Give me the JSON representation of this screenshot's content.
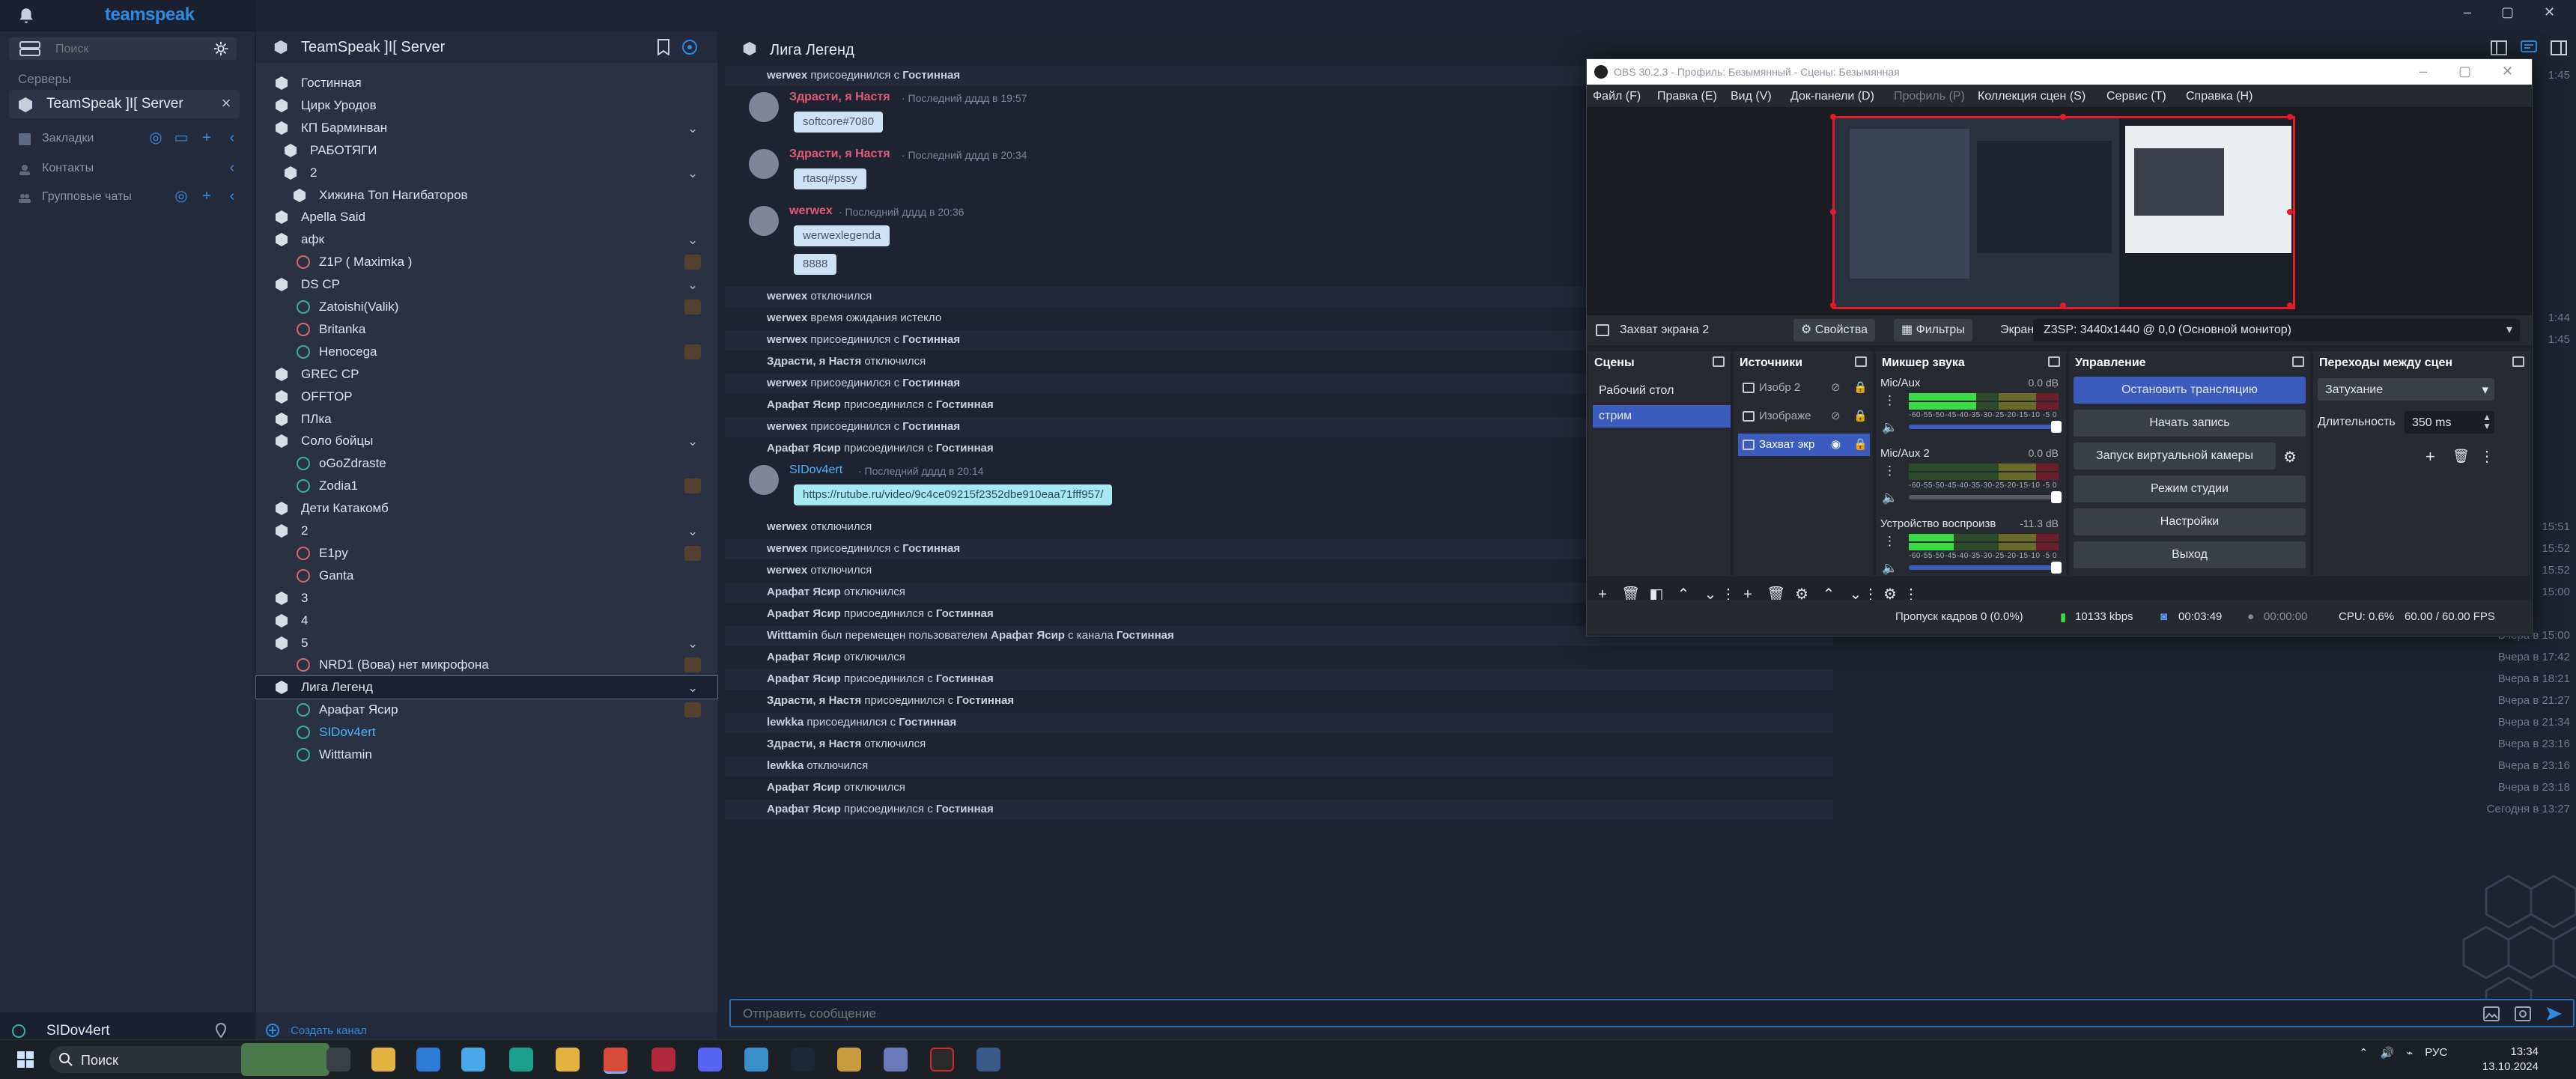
{
  "sidebar": {
    "brand": "teamspeak",
    "search_placeholder": "Поиск",
    "servers_label": "Серверы",
    "server_name": "TeamSpeak ]I[ Server",
    "sections": [
      "Закладки",
      "Контакты",
      "Групповые чаты"
    ],
    "user_name": "SIDov4ert"
  },
  "tree": {
    "server_title": "TeamSpeak ]I[ Server",
    "rows": [
      {
        "type": "channel",
        "label": "Гостинная",
        "depth": 0
      },
      {
        "type": "channel",
        "label": "Цирк Уродов",
        "depth": 0
      },
      {
        "type": "channel",
        "label": "КП Барминван",
        "depth": 0,
        "chev": true
      },
      {
        "type": "channel",
        "label": "РАБОТЯГИ",
        "depth": 1
      },
      {
        "type": "channel",
        "label": "2",
        "depth": 1,
        "chev": true
      },
      {
        "type": "channel",
        "label": "Хижина Топ Нагибаторов",
        "depth": 2
      },
      {
        "type": "channel",
        "label": "Apella Said",
        "depth": 0
      },
      {
        "type": "channel",
        "label": "афк",
        "depth": 0,
        "chev": true
      },
      {
        "type": "user-mic",
        "label": "Z1P ( Maximka )",
        "depth": 1,
        "badge": true
      },
      {
        "type": "channel",
        "label": "DS CP",
        "depth": 0,
        "chev": true
      },
      {
        "type": "user",
        "label": "Zatoishi(Valik)",
        "depth": 1,
        "badge": true
      },
      {
        "type": "user-mic",
        "label": "Britanka",
        "depth": 1
      },
      {
        "type": "user",
        "label": "Henocega",
        "depth": 1,
        "badge": true
      },
      {
        "type": "channel",
        "label": "GREC CP",
        "depth": 0
      },
      {
        "type": "channel",
        "label": "OFFTOP",
        "depth": 0
      },
      {
        "type": "channel",
        "label": "ПЛка",
        "depth": 0
      },
      {
        "type": "channel",
        "label": "Соло бойцы",
        "depth": 0,
        "chev": true
      },
      {
        "type": "user",
        "label": "oGoZdraste",
        "depth": 1
      },
      {
        "type": "user",
        "label": "Zodia1",
        "depth": 1,
        "badge": true
      },
      {
        "type": "channel",
        "label": "Дети Катакомб",
        "depth": 0
      },
      {
        "type": "channel",
        "label": "2",
        "depth": 0,
        "chev": true
      },
      {
        "type": "user-mic",
        "label": "E1py",
        "depth": 1,
        "badge": true
      },
      {
        "type": "user-mic",
        "label": "Ganta",
        "depth": 1
      },
      {
        "type": "channel",
        "label": "3",
        "depth": 0
      },
      {
        "type": "channel",
        "label": "4",
        "depth": 0
      },
      {
        "type": "channel",
        "label": "5",
        "depth": 0,
        "chev": true
      },
      {
        "type": "user-mic",
        "label": "NRD1 (Вова) нет микрофона",
        "depth": 1,
        "badge": true
      },
      {
        "type": "channel-sel",
        "label": "Лига Легенд",
        "depth": 0,
        "chev": true
      },
      {
        "type": "user",
        "label": "Арафат Ясир",
        "depth": 1,
        "badge": true
      },
      {
        "type": "user-me",
        "label": "SIDov4ert",
        "depth": 1
      },
      {
        "type": "user",
        "label": "Witttamin",
        "depth": 1
      }
    ],
    "create_channel": "Создать канал"
  },
  "chat": {
    "title": "Лига Легенд",
    "messages": [
      {
        "kind": "event",
        "html_parts": [
          {
            "b": "werwex"
          },
          {
            "t": " присоединился с "
          },
          {
            "b": "Гостинная"
          }
        ]
      },
      {
        "kind": "msg",
        "name": "Здрасти, я Настя",
        "time": "· Последний дддд в 19:57",
        "bubble": "softcore#7080"
      },
      {
        "kind": "msg",
        "name": "Здрасти, я Настя",
        "time": "· Последний дддд в 20:34",
        "bubble": "rtasq#pssy"
      },
      {
        "kind": "msg2",
        "name": "werwex",
        "time": "· Последний дддд в 20:36",
        "bubbles": [
          "werwexlegenda",
          "8888"
        ]
      },
      {
        "kind": "event",
        "html_parts": [
          {
            "b": "werwex"
          },
          {
            "t": " отключился"
          }
        ]
      },
      {
        "kind": "event",
        "html_parts": [
          {
            "b": "werwex"
          },
          {
            "t": " время ожидания истекло"
          }
        ]
      },
      {
        "kind": "event",
        "html_parts": [
          {
            "b": "werwex"
          },
          {
            "t": " присоединился с "
          },
          {
            "b": "Гостинная"
          }
        ]
      },
      {
        "kind": "event",
        "html_parts": [
          {
            "b": "Здрасти, я Настя"
          },
          {
            "t": " отключился"
          }
        ]
      },
      {
        "kind": "event",
        "html_parts": [
          {
            "b": "werwex"
          },
          {
            "t": " присоединился с "
          },
          {
            "b": "Гостинная"
          }
        ]
      },
      {
        "kind": "event",
        "html_parts": [
          {
            "b": "Арафат Ясир"
          },
          {
            "t": " присоединился с "
          },
          {
            "b": "Гостинная"
          }
        ]
      },
      {
        "kind": "event",
        "html_parts": [
          {
            "b": "werwex"
          },
          {
            "t": " присоединился с "
          },
          {
            "b": "Гостинная"
          }
        ]
      },
      {
        "kind": "event",
        "html_parts": [
          {
            "b": "Арафат Ясир"
          },
          {
            "t": " присоединился с "
          },
          {
            "b": "Гостинная"
          }
        ]
      },
      {
        "kind": "msglink",
        "name": "SIDov4ert",
        "time": "· Последний дддд в 20:14",
        "bubble": "https://rutube.ru/video/9c4ce09215f2352dbe910eaa71fff957/"
      },
      {
        "kind": "event",
        "html_parts": [
          {
            "b": "werwex"
          },
          {
            "t": " отключился"
          }
        ]
      },
      {
        "kind": "event",
        "html_parts": [
          {
            "b": "werwex"
          },
          {
            "t": " присоединился с "
          },
          {
            "b": "Гостинная"
          }
        ]
      },
      {
        "kind": "event",
        "html_parts": [
          {
            "b": "werwex"
          },
          {
            "t": " отключился"
          }
        ]
      },
      {
        "kind": "event",
        "html_parts": [
          {
            "b": "Арафат Ясир"
          },
          {
            "t": " отключился"
          }
        ]
      },
      {
        "kind": "event",
        "html_parts": [
          {
            "b": "Арафат Ясир"
          },
          {
            "t": " присоединился с "
          },
          {
            "b": "Гостинная"
          }
        ]
      },
      {
        "kind": "event",
        "html_parts": [
          {
            "b": "Witttamin"
          },
          {
            "t": " был перемещен пользователем "
          },
          {
            "b": "Арафат Ясир"
          },
          {
            "t": " с канала "
          },
          {
            "b": "Гостинная"
          }
        ]
      },
      {
        "kind": "event",
        "html_parts": [
          {
            "b": "Арафат Ясир"
          },
          {
            "t": " отключился"
          }
        ]
      },
      {
        "kind": "event",
        "html_parts": [
          {
            "b": "Арафат Ясир"
          },
          {
            "t": " присоединился с "
          },
          {
            "b": "Гостинная"
          }
        ]
      },
      {
        "kind": "event",
        "html_parts": [
          {
            "b": "Здрасти, я Настя"
          },
          {
            "t": " присоединился с "
          },
          {
            "b": "Гостинная"
          }
        ]
      },
      {
        "kind": "event",
        "html_parts": [
          {
            "b": "lewkka"
          },
          {
            "t": " присоединился с "
          },
          {
            "b": "Гостинная"
          }
        ]
      },
      {
        "kind": "event",
        "html_parts": [
          {
            "b": "Здрасти, я Настя"
          },
          {
            "t": " отключился"
          }
        ]
      },
      {
        "kind": "event",
        "html_parts": [
          {
            "b": "lewkka"
          },
          {
            "t": " отключился"
          }
        ]
      },
      {
        "kind": "event",
        "html_parts": [
          {
            "b": "Арафат Ясир"
          },
          {
            "t": " отключился"
          }
        ]
      },
      {
        "kind": "event",
        "html_parts": [
          {
            "b": "Арафат Ясир"
          },
          {
            "t": " присоединился с "
          },
          {
            "b": "Гостинная"
          }
        ]
      }
    ],
    "timestamps": [
      {
        "row": 0,
        "text": "1:45"
      },
      {
        "row": 5,
        "text": "1:44"
      },
      {
        "row": 6,
        "text": "1:45"
      },
      {
        "row": 13,
        "text": "15:51"
      },
      {
        "row": 14,
        "text": "15:52"
      },
      {
        "row": 15,
        "text": "15:52"
      },
      {
        "row": 16,
        "text": "15:00"
      },
      {
        "row": 18,
        "text": "Вчера в 15:00"
      },
      {
        "row": 19,
        "text": "Вчера в 17:42"
      },
      {
        "row": 20,
        "text": "Вчера в 18:21"
      },
      {
        "row": 21,
        "text": "Вчера в 21:27"
      },
      {
        "row": 22,
        "text": "Вчера в 21:34"
      },
      {
        "row": 23,
        "text": "Вчера в 23:16"
      },
      {
        "row": 24,
        "text": "Вчера в 23:16"
      },
      {
        "row": 25,
        "text": "Вчера в 23:18"
      },
      {
        "row": 26,
        "text": "Сегодня в 13:27"
      }
    ],
    "input_placeholder": "Отправить сообщение"
  },
  "obs": {
    "title": "OBS 30.2.3 - Профиль: Безымянный - Сцены: Безымянная",
    "menu": [
      "Файл (F)",
      "Правка (E)",
      "Вид (V)",
      "Док-панели (D)",
      "Профиль (P)",
      "Коллекция сцен (S)",
      "Сервис (T)",
      "Справка (H)"
    ],
    "source_name": "Захват экрана 2",
    "props_btn": "Свойства",
    "filters_btn": "Фильтры",
    "screen_label": "Экран",
    "screen_value": "Z3SP: 3440x1440 @ 0,0 (Основной монитор)",
    "docks": {
      "scenes": "Сцены",
      "sources": "Источники",
      "mixer": "Микшер звука",
      "controls": "Управление",
      "transitions": "Переходы между сцен"
    },
    "scenes": [
      "Рабочий стол",
      "стрим"
    ],
    "sources": [
      "Изобр 2",
      "Изображе",
      "Захват экр"
    ],
    "mixer": [
      {
        "name": "Mic/Aux",
        "db": "0.0 dB",
        "level": 0.45
      },
      {
        "name": "Mic/Aux 2",
        "db": "0.0 dB",
        "level": 0
      },
      {
        "name": "Устройство воспроизв",
        "db": "-11.3 dB",
        "level": 0.3
      }
    ],
    "mixer_ticks": "-60-55-50-45-40-35-30-25-20-15-10 -5  0",
    "controls": [
      "Остановить трансляцию",
      "Начать запись",
      "Запуск виртуальной камеры",
      "Режим студии",
      "Настройки",
      "Выход"
    ],
    "transition_type": "Затухание",
    "duration_label": "Длительность",
    "duration_value": "350 ms",
    "status": {
      "dropped": "Пропуск кадров 0 (0.0%)",
      "bitrate": "10133 kbps",
      "stream_time": "00:03:49",
      "rec_time": "00:00:00",
      "cpu": "CPU: 0.6%",
      "fps": "60.00 / 60.00 FPS"
    }
  },
  "taskbar": {
    "search": "Поиск",
    "lang": "РУС",
    "time": "13:34",
    "date": "13.10.2024"
  }
}
